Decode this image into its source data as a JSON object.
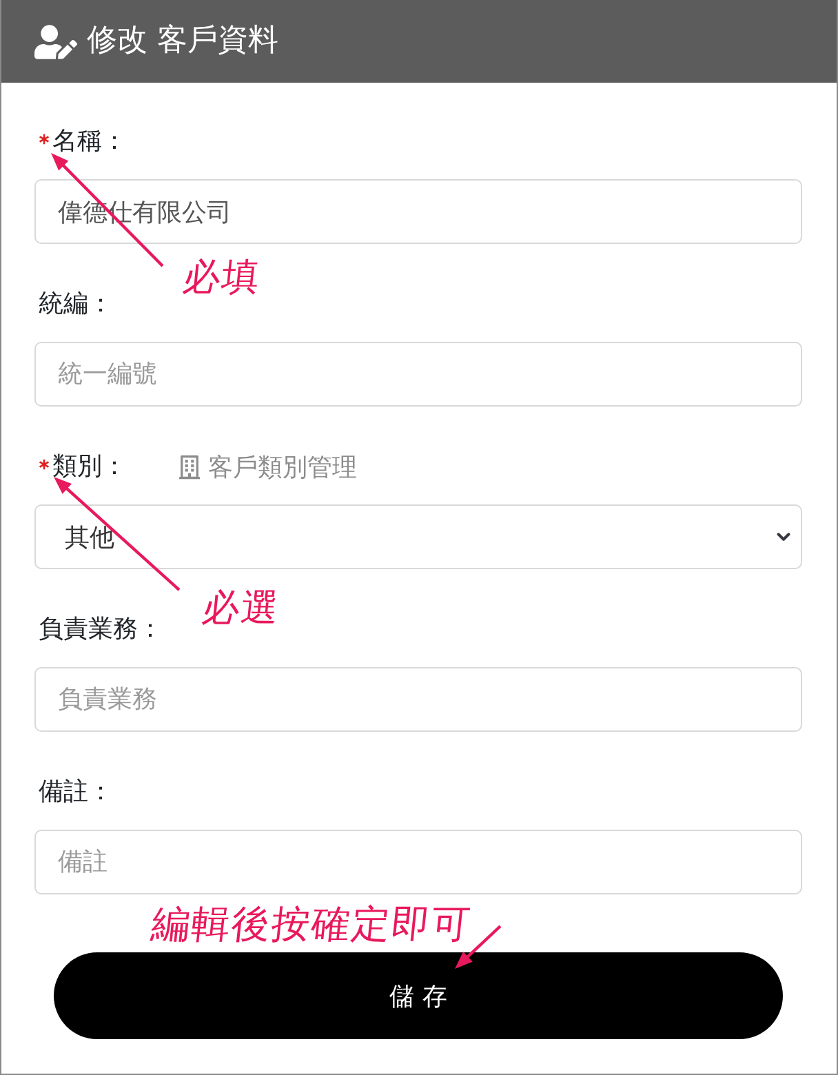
{
  "header": {
    "title": "修改 客戶資料"
  },
  "fields": [
    {
      "kind": "input",
      "label": "名稱：",
      "required": true,
      "value": "偉德仕有限公司",
      "annotation": "必填"
    },
    {
      "kind": "input",
      "label": "統編：",
      "required": false,
      "placeholder": "統一編號"
    },
    {
      "kind": "select",
      "label": "類別：",
      "required": true,
      "link": "客戶類別管理",
      "value": "其他",
      "annotation": "必選"
    },
    {
      "kind": "input",
      "label": "負責業務：",
      "required": false,
      "placeholder": "負責業務"
    },
    {
      "kind": "input",
      "label": "備註：",
      "required": false,
      "placeholder": "備註"
    }
  ],
  "save_button": {
    "label": "儲 存",
    "annotation": "編輯後按確定即可"
  }
}
